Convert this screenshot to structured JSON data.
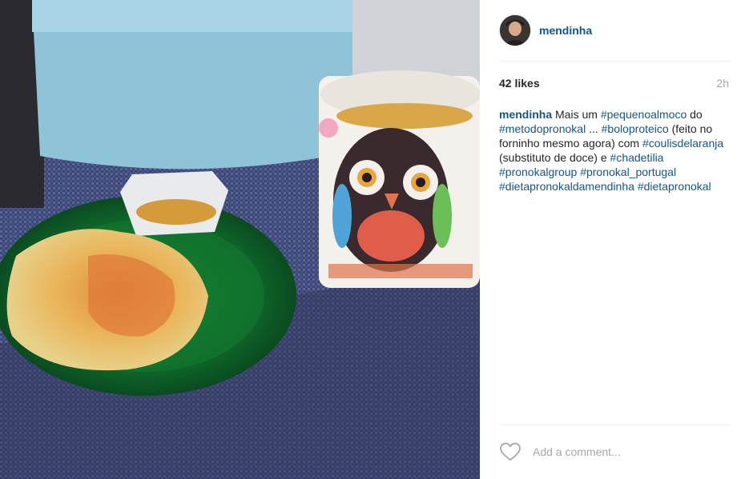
{
  "post": {
    "username": "mendinha",
    "likes": "42 likes",
    "time_ago": "2h",
    "comment_placeholder": "Add a comment...",
    "caption": [
      {
        "type": "user",
        "text": "mendinha"
      },
      {
        "type": "text",
        "text": " Mais um "
      },
      {
        "type": "tag",
        "text": "#pequenoalmoco"
      },
      {
        "type": "text",
        "text": " do "
      },
      {
        "type": "tag",
        "text": "#metodopronokal"
      },
      {
        "type": "text",
        "text": " ... "
      },
      {
        "type": "tag",
        "text": "#boloproteico"
      },
      {
        "type": "text",
        "text": " (feito no forninho mesmo agora) com "
      },
      {
        "type": "tag",
        "text": "#coulisdelaranja"
      },
      {
        "type": "text",
        "text": " (substituto de doce) e "
      },
      {
        "type": "tag",
        "text": "#chadetilia"
      },
      {
        "type": "text",
        "text": " "
      },
      {
        "type": "tag",
        "text": "#pronokalgroup"
      },
      {
        "type": "text",
        "text": " "
      },
      {
        "type": "tag",
        "text": "#pronokal_portugal"
      },
      {
        "type": "text",
        "text": " "
      },
      {
        "type": "tag",
        "text": "#dietapronokaldamendinha"
      },
      {
        "type": "text",
        "text": " "
      },
      {
        "type": "tag",
        "text": "#dietapronokal"
      }
    ]
  },
  "icons": {
    "like": "heart-outline-icon"
  },
  "colors": {
    "link": "#125688",
    "muted": "#a5a7aa",
    "text": "#262626"
  }
}
